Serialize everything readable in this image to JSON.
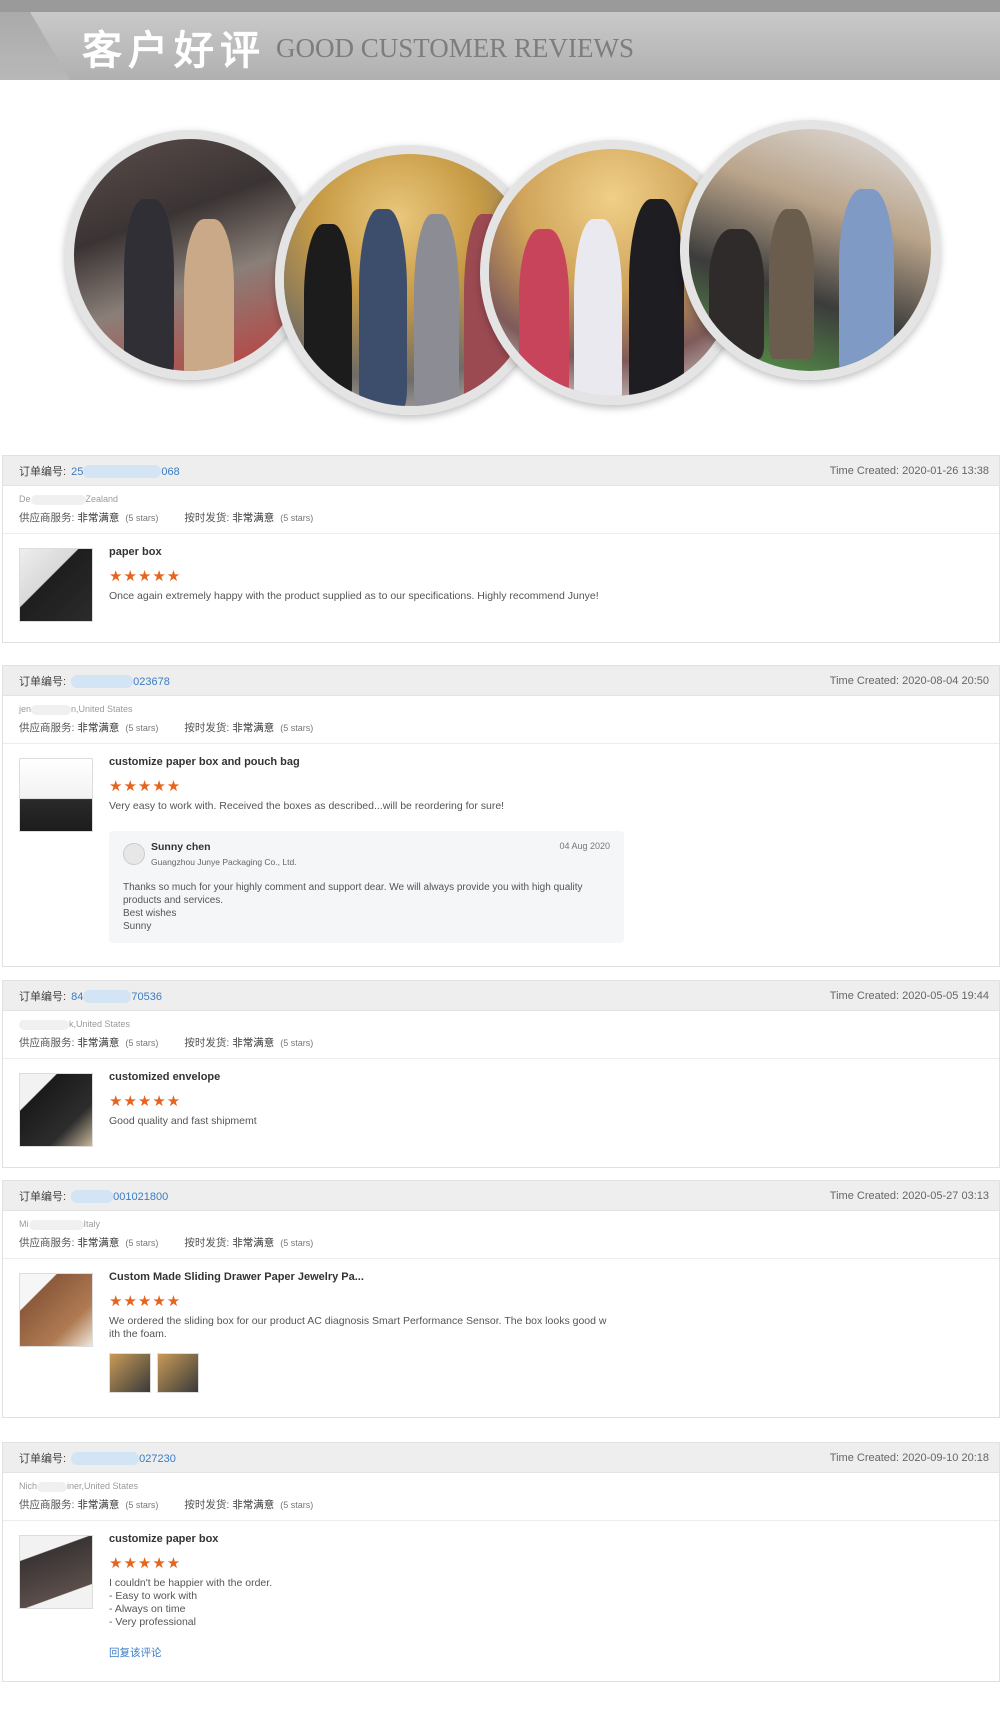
{
  "banner": {
    "title_cn": "客户好评",
    "title_en": "GOOD CUSTOMER REVIEWS"
  },
  "labels": {
    "order": "订单编号:",
    "supplier_service": "供应商服务:",
    "on_time": "按时发货:",
    "very_satisfied": "非常满意",
    "five_stars": "(5 stars)",
    "stars": "★★★★★"
  },
  "reviews": [
    {
      "order_no_prefix": "25",
      "order_no_suffix": "068",
      "time": "Time Created: 2020-01-26 13:38",
      "buyer_prefix": "De",
      "buyer_suffix": "Zealand",
      "product": "paper box",
      "comment": "Once again extremely happy with the product supplied as to our specifications. Highly recommend Junye!"
    },
    {
      "order_no_prefix": "",
      "order_no_suffix": "023678",
      "time": "Time Created: 2020-08-04 20:50",
      "buyer_prefix": "jen",
      "buyer_suffix": "n,United States",
      "product": "customize paper box and pouch bag",
      "comment": "Very easy to work with. Received the boxes as described...will be reordering for sure!",
      "reply": {
        "name": "Sunny chen",
        "date": "04 Aug 2020",
        "company": "Guangzhou Junye Packaging Co., Ltd.",
        "text": "Thanks so much for your highly comment and support dear. We will always provide you with high quality\nproducts and services.\nBest wishes\nSunny"
      }
    },
    {
      "order_no_prefix": "84",
      "order_no_suffix": "70536",
      "time": "Time Created: 2020-05-05 19:44",
      "buyer_prefix": "",
      "buyer_suffix": "k,United States",
      "product": "customized envelope",
      "comment": "Good quality and fast shipmemt"
    },
    {
      "order_no_prefix": "",
      "order_no_suffix": "001021800",
      "time": "Time Created: 2020-05-27 03:13",
      "buyer_prefix": "Mi",
      "buyer_suffix": "Italy",
      "product": "Custom Made Sliding Drawer Paper Jewelry Pa...",
      "comment": "We ordered the sliding box for our product AC diagnosis Smart Performance Sensor. The box looks good w\nith the foam."
    },
    {
      "order_no_prefix": "",
      "order_no_suffix": "027230",
      "time": "Time Created: 2020-09-10 20:18",
      "buyer_prefix": "Nich",
      "buyer_suffix": "iner,United States",
      "product": "customize paper box",
      "comment": "I couldn't be happier with the order.\n- Easy to work with\n- Always on time\n- Very professional",
      "reply_link": "回复该评论"
    }
  ]
}
